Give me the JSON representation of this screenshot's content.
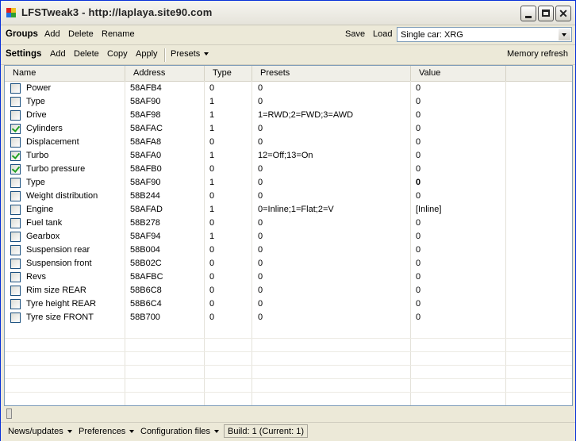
{
  "window": {
    "title": "LFSTweak3 - http://laplaya.site90.com"
  },
  "groups_toolbar": {
    "label": "Groups",
    "add": "Add",
    "delete": "Delete",
    "rename": "Rename",
    "save": "Save",
    "load": "Load",
    "car_select": "Single car: XRG"
  },
  "settings_toolbar": {
    "label": "Settings",
    "add": "Add",
    "delete": "Delete",
    "copy": "Copy",
    "apply": "Apply",
    "presets": "Presets",
    "memory_refresh": "Memory refresh"
  },
  "grid": {
    "columns": [
      "Name",
      "Address",
      "Type",
      "Presets",
      "Value"
    ],
    "rows": [
      {
        "checked": false,
        "name": "Power",
        "address": "58AFB4",
        "type": "0",
        "presets": "0",
        "value": "0"
      },
      {
        "checked": false,
        "name": "Type",
        "address": "58AF90",
        "type": "1",
        "presets": "0",
        "value": "0"
      },
      {
        "checked": false,
        "name": "Drive",
        "address": "58AF98",
        "type": "1",
        "presets": "1=RWD;2=FWD;3=AWD",
        "value": "0"
      },
      {
        "checked": true,
        "name": "Cylinders",
        "address": "58AFAC",
        "type": "1",
        "presets": "0",
        "value": "0"
      },
      {
        "checked": false,
        "name": "Displacement",
        "address": "58AFA8",
        "type": "0",
        "presets": "0",
        "value": "0"
      },
      {
        "checked": true,
        "name": "Turbo",
        "address": "58AFA0",
        "type": "1",
        "presets": "12=Off;13=On",
        "value": "0"
      },
      {
        "checked": true,
        "name": "Turbo pressure",
        "address": "58AFB0",
        "type": "0",
        "presets": "0",
        "value": "0"
      },
      {
        "checked": false,
        "name": "Type",
        "address": "58AF90",
        "type": "1",
        "presets": "0",
        "value": "0",
        "bold": true
      },
      {
        "checked": false,
        "name": "Weight distribution",
        "address": "58B244",
        "type": "0",
        "presets": "0",
        "value": "0"
      },
      {
        "checked": false,
        "name": "Engine",
        "address": "58AFAD",
        "type": "1",
        "presets": "0=Inline;1=Flat;2=V",
        "value": "[Inline]"
      },
      {
        "checked": false,
        "name": "Fuel tank",
        "address": "58B278",
        "type": "0",
        "presets": "0",
        "value": "0"
      },
      {
        "checked": false,
        "name": "Gearbox",
        "address": "58AF94",
        "type": "1",
        "presets": "0",
        "value": "0"
      },
      {
        "checked": false,
        "name": "Suspension rear",
        "address": "58B004",
        "type": "0",
        "presets": "0",
        "value": "0"
      },
      {
        "checked": false,
        "name": "Suspension front",
        "address": "58B02C",
        "type": "0",
        "presets": "0",
        "value": "0"
      },
      {
        "checked": false,
        "name": "Revs",
        "address": "58AFBC",
        "type": "0",
        "presets": "0",
        "value": "0"
      },
      {
        "checked": false,
        "name": "Rim size REAR",
        "address": "58B6C8",
        "type": "0",
        "presets": "0",
        "value": "0"
      },
      {
        "checked": false,
        "name": "Tyre height REAR",
        "address": "58B6C4",
        "type": "0",
        "presets": "0",
        "value": "0"
      },
      {
        "checked": false,
        "name": "Tyre size FRONT",
        "address": "58B700",
        "type": "0",
        "presets": "0",
        "value": "0"
      }
    ]
  },
  "statusbar": {
    "news": "News/updates",
    "preferences": "Preferences",
    "config_files": "Configuration files",
    "build": "Build: 1 (Current: 1)"
  }
}
